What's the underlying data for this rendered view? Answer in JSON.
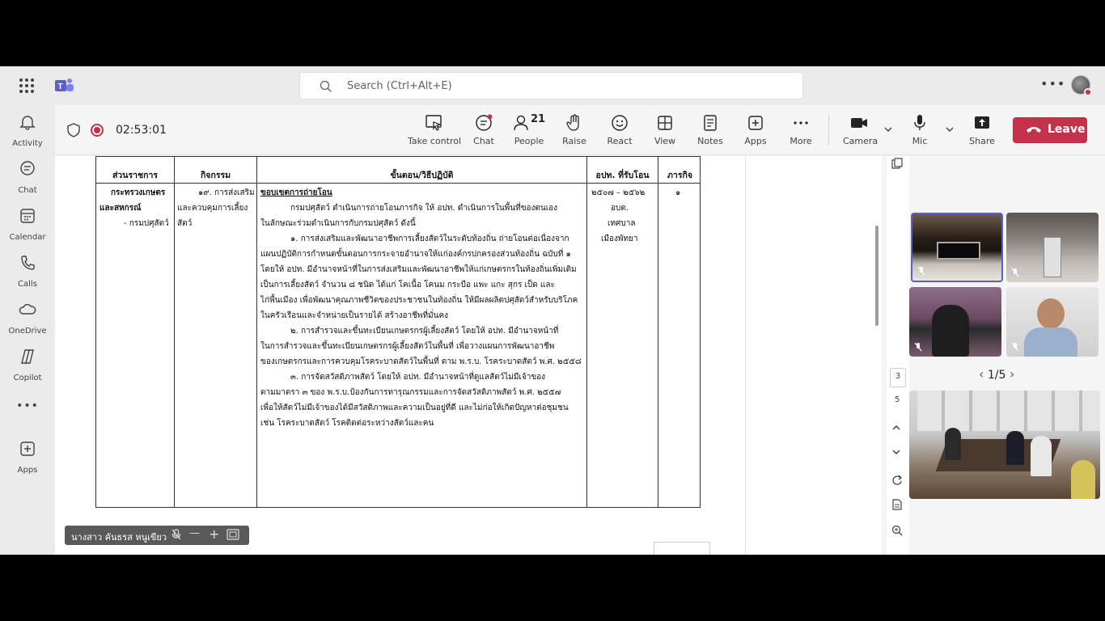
{
  "search": {
    "placeholder": "Search (Ctrl+Alt+E)"
  },
  "rail": {
    "items": [
      {
        "label": "Activity",
        "icon": "bell-icon"
      },
      {
        "label": "Chat",
        "icon": "chat-icon"
      },
      {
        "label": "Calendar",
        "icon": "calendar-icon"
      },
      {
        "label": "Calls",
        "icon": "phone-icon"
      },
      {
        "label": "OneDrive",
        "icon": "cloud-icon"
      },
      {
        "label": "Copilot",
        "icon": "copilot-icon"
      },
      {
        "label": "Apps",
        "icon": "apps-plus-icon"
      }
    ]
  },
  "meeting": {
    "timer": "02:53:01",
    "buttons": {
      "take_control": "Take control",
      "chat": "Chat",
      "people": "People",
      "people_count": "21",
      "raise": "Raise",
      "react": "React",
      "view": "View",
      "notes": "Notes",
      "apps": "Apps",
      "more": "More",
      "camera": "Camera",
      "mic": "Mic",
      "share": "Share",
      "leave": "Leave"
    }
  },
  "document": {
    "headers": {
      "col1": "ส่วนราชการ",
      "col2": "กิจกรรม",
      "col3": "ขั้นตอน/วิธีปฏิบัติ",
      "col4": "อปท. ที่รับโอน",
      "col5": "ภารกิจ"
    },
    "col1_lines": [
      "กระทรวงเกษตร",
      "และสหกรณ์",
      "- กรมปศุสัตว์"
    ],
    "col2_lines": [
      "๑๙. การส่งเสริม",
      "และควบคุมการเลี้ยง",
      "สัตว์"
    ],
    "col3_title": "ขอบเขตการถ่ายโอน",
    "col3_lines": [
      "กรมปศุสัตว์ ดำเนินการถ่ายโอนภารกิจ ให้ อปท. ดำเนินการในพื้นที่ของตนเอง",
      "ในลักษณะร่วมดำเนินการกับกรมปศุสัตว์ ดังนี้",
      "๑. การส่งเสริมและพัฒนาอาชีพการเลี้ยงสัตว์ในระดับท้องถิ่น ถ่ายโอนต่อเนื่องจาก",
      "แผนปฏิบัติการกำหนดขั้นตอนการกระจายอำนาจให้แก่องค์กรปกครองส่วนท้องถิ่น ฉบับที่ ๑",
      "โดยให้ อปท. มีอำนาจหน้าที่ในการส่งเสริมและพัฒนาอาชีพให้แก่เกษตรกรในท้องถิ่นเพิ่มเติม",
      "เป็นการเลี้ยงสัตว์ จำนวน ๘ ชนิด ได้แก่ โคเนื้อ โคนม กระบือ แพะ แกะ สุกร เป็ด และ",
      "ไก่พื้นเมือง เพื่อพัฒนาคุณภาพชีวิตของประชาชนในท้องถิ่น ให้มีผลผลิตปศุสัตว์สำหรับบริโภค",
      "ในครัวเรือนและจำหน่ายเป็นรายได้ สร้างอาชีพที่มั่นคง",
      "๒. การสำรวจและขึ้นทะเบียนเกษตรกรผู้เลี้ยงสัตว์ โดยให้ อปท. มีอำนาจหน้าที่",
      "ในการสำรวจและขึ้นทะเบียนเกษตรกรผู้เลี้ยงสัตว์ในพื้นที่ เพื่อวางแผนการพัฒนาอาชีพ",
      "ของเกษตรกรและการควบคุมโรคระบาดสัตว์ในพื้นที่ ตาม พ.ร.บ. โรคระบาดสัตว์ พ.ศ. ๒๕๕๘",
      "๓. การจัดสวัสดิภาพสัตว์ โดยให้ อปท. มีอำนาจหน้าที่ดูแลสัตว์ไม่มีเจ้าของ",
      "ตามมาตรา ๓ ของ พ.ร.บ.ป้องกันการทารุณกรรมและการจัดสวัสดิภาพสัตว์ พ.ศ. ๒๕๕๗",
      "เพื่อให้สัตว์ไม่มีเจ้าของได้มีสวัสดิภาพและความเป็นอยู่ที่ดี และไม่ก่อให้เกิดปัญหาต่อชุมชน",
      "เช่น โรคระบาดสัตว์ โรคติดต่อระหว่างสัตว์และคน"
    ],
    "col4_lines": [
      "๒๕๐๗ – ๒๕๖๒",
      "อบต.",
      "เทศบาล",
      "เมืองพัทยา"
    ],
    "col5_lines": [
      "๑"
    ]
  },
  "presenter": {
    "name": "นางสาว คันธรส หนูเขียว"
  },
  "side": {
    "page_a": "3",
    "page_b": "5"
  },
  "gallery": {
    "pager": "1/5"
  }
}
